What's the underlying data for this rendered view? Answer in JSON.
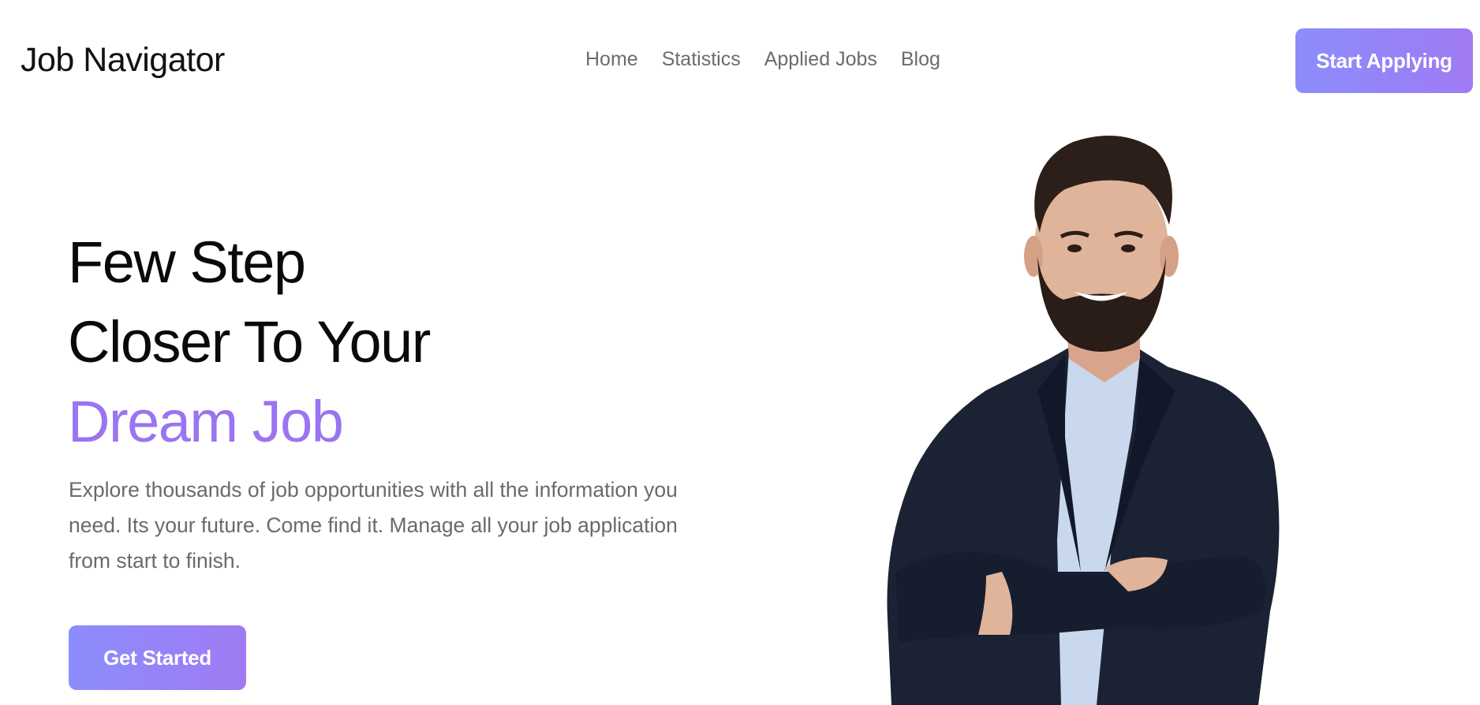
{
  "header": {
    "logo": "Job Navigator",
    "nav": [
      "Home",
      "Statistics",
      "Applied Jobs",
      "Blog"
    ],
    "cta_label": "Start Applying"
  },
  "hero": {
    "title_line1": "Few Step",
    "title_line2": "Closer To Your",
    "title_accent": "Dream Job",
    "description": "Explore thousands of job opportunities with all the information you need. Its your future. Come find it. Manage all your job application from start to finish.",
    "button_label": "Get Started"
  },
  "colors": {
    "accent": "#9a74f2",
    "gradient_start": "#8b8dfc",
    "gradient_end": "#a07af3"
  }
}
